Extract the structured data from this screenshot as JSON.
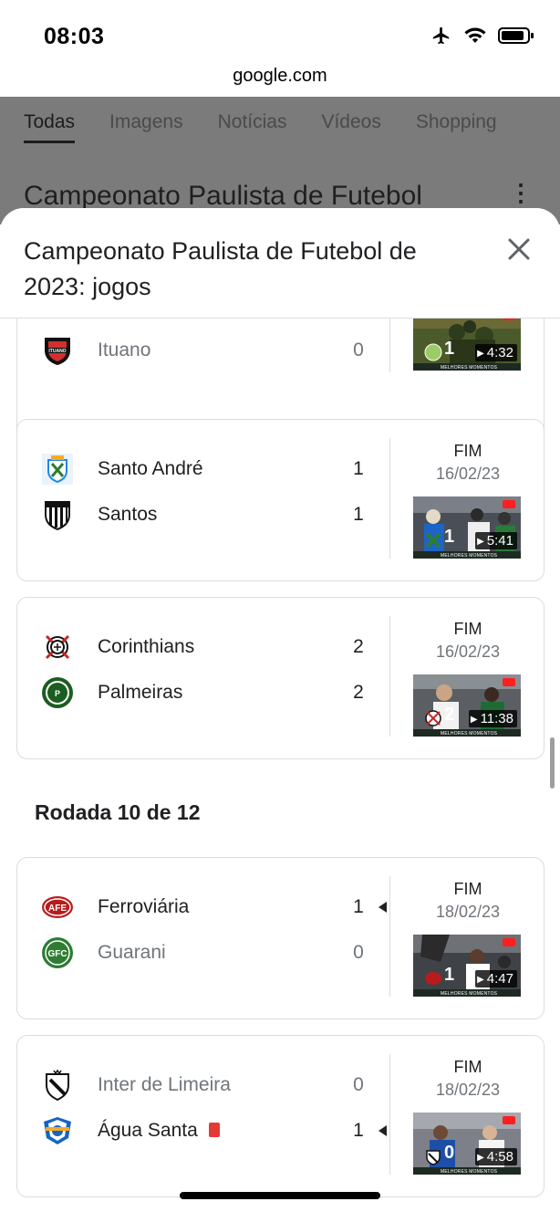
{
  "status_bar": {
    "time": "08:03",
    "url": "google.com"
  },
  "background_page": {
    "tabs": [
      "Todas",
      "Imagens",
      "Notícias",
      "Vídeos",
      "Shopping"
    ],
    "active_tab": "Todas",
    "title": "Campeonato Paulista de Futebol"
  },
  "sheet": {
    "title": "Campeonato Paulista de Futebol de 2023: jogos",
    "close_icon": "close-icon"
  },
  "matches_top": [
    {
      "team2": {
        "name": "Ituano",
        "score": "0",
        "logo": "ituano-logo",
        "color": "#c62828"
      },
      "video": {
        "duration": "4:32",
        "score_glyph": "1"
      }
    },
    {
      "team1": {
        "name": "Santo André",
        "score": "1",
        "logo": "santo-andre-logo",
        "color": "#1e88e5"
      },
      "team2": {
        "name": "Santos",
        "score": "1",
        "logo": "santos-logo",
        "color": "#000000"
      },
      "status": "FIM",
      "date": "16/02/23",
      "video": {
        "duration": "5:41",
        "score_glyph": "1"
      }
    },
    {
      "team1": {
        "name": "Corinthians",
        "score": "2",
        "logo": "corinthians-logo",
        "color": "#000000"
      },
      "team2": {
        "name": "Palmeiras",
        "score": "2",
        "logo": "palmeiras-logo",
        "color": "#1b5e20"
      },
      "status": "FIM",
      "date": "16/02/23",
      "video": {
        "duration": "11:38",
        "score_glyph": "2"
      }
    }
  ],
  "round": {
    "heading": "Rodada 10 de 12"
  },
  "matches_round10": [
    {
      "team1": {
        "name": "Ferroviária",
        "score": "1",
        "logo": "ferroviaria-logo",
        "color": "#b71c1c",
        "winner": true
      },
      "team2": {
        "name": "Guarani",
        "score": "0",
        "logo": "guarani-logo",
        "color": "#2e7d32"
      },
      "status": "FIM",
      "date": "18/02/23",
      "video": {
        "duration": "4:47",
        "score_glyph": "1"
      }
    },
    {
      "team1": {
        "name": "Inter de Limeira",
        "score": "0",
        "logo": "inter-limeira-logo",
        "color": "#000000"
      },
      "team2": {
        "name": "Água Santa",
        "score": "1",
        "logo": "agua-santa-logo",
        "color": "#1565c0",
        "winner": true,
        "red_card": true
      },
      "status": "FIM",
      "date": "18/02/23",
      "video": {
        "duration": "4:58",
        "score_glyph": "0"
      }
    }
  ],
  "video_strip_text": "MELHORES MOMENTOS"
}
